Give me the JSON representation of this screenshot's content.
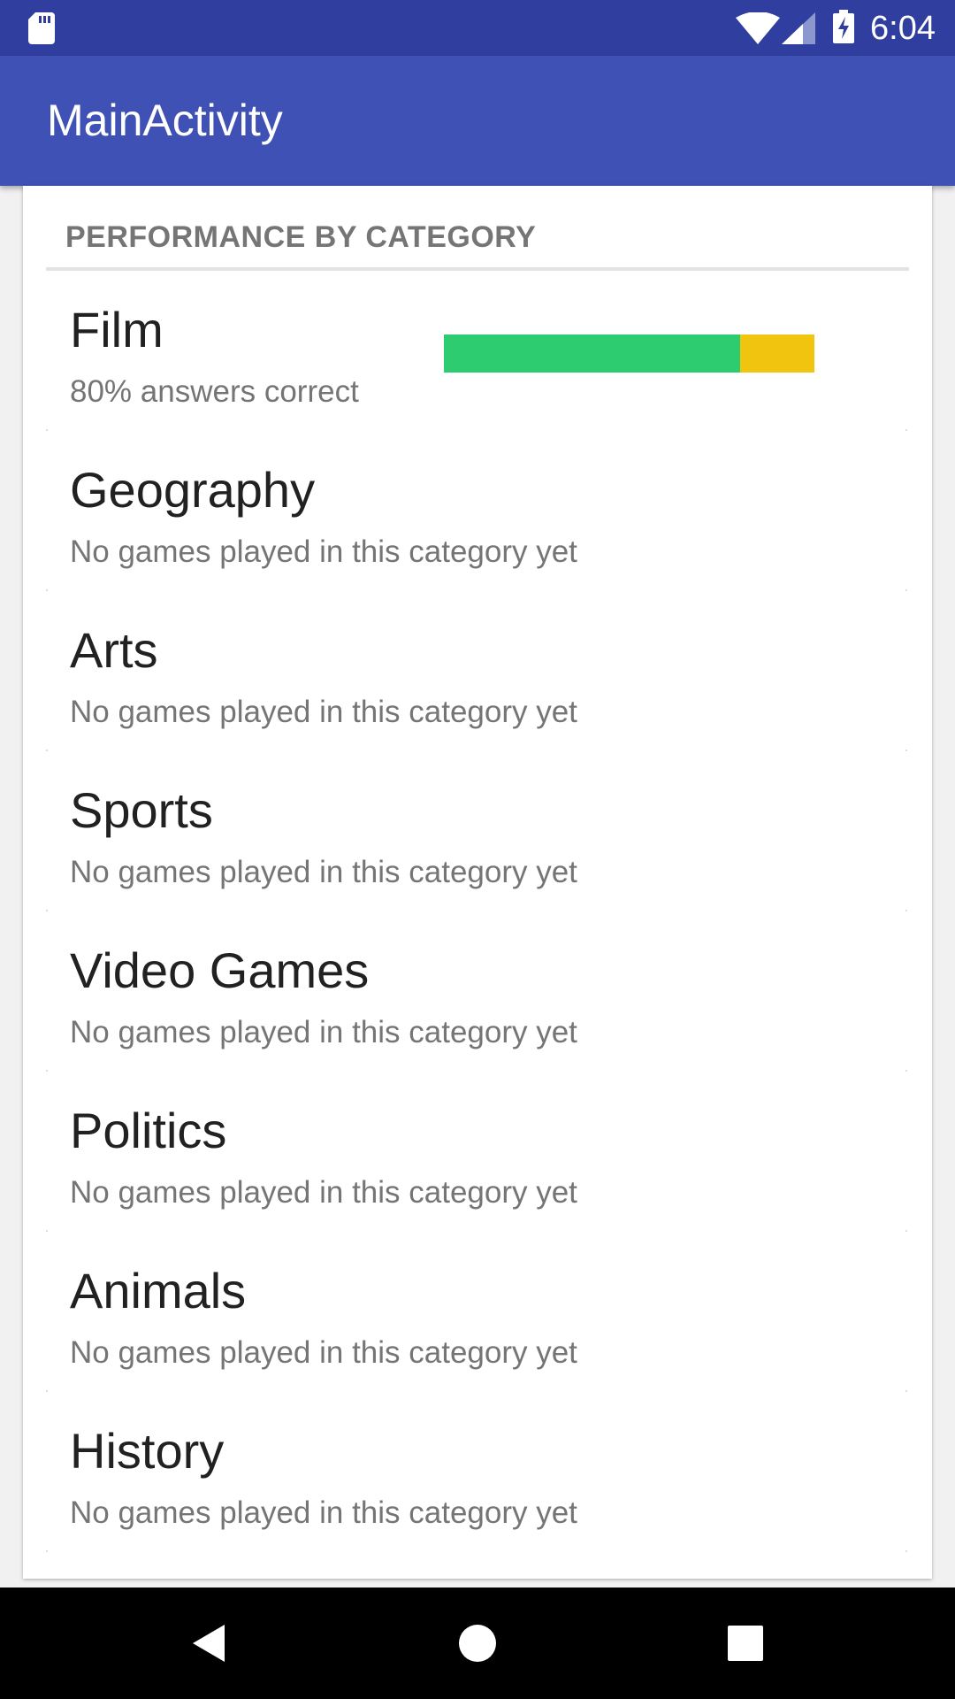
{
  "status_bar": {
    "time": "6:04",
    "icons": [
      "sd-card-icon",
      "wifi-icon",
      "cell-signal-icon",
      "battery-charging-icon"
    ]
  },
  "app_bar": {
    "title": "MainActivity"
  },
  "card": {
    "header": "PERFORMANCE BY CATEGORY",
    "items": [
      {
        "name": "Film",
        "subtitle": "80% answers correct",
        "correct_fraction": 0.8
      },
      {
        "name": "Geography",
        "subtitle": "No games played in this category yet"
      },
      {
        "name": "Arts",
        "subtitle": "No games played in this category yet"
      },
      {
        "name": "Sports",
        "subtitle": "No games played in this category yet"
      },
      {
        "name": "Video Games",
        "subtitle": "No games played in this category yet"
      },
      {
        "name": "Politics",
        "subtitle": "No games played in this category yet"
      },
      {
        "name": "Animals",
        "subtitle": "No games played in this category yet"
      },
      {
        "name": "History",
        "subtitle": "No games played in this category yet"
      }
    ]
  },
  "colors": {
    "status_bar": "#303f9f",
    "app_bar": "#3f51b5",
    "correct": "#2ecc71",
    "incorrect": "#f1c40f"
  },
  "nav_bar": {
    "icons": [
      "back-icon",
      "home-icon",
      "recents-icon"
    ]
  }
}
